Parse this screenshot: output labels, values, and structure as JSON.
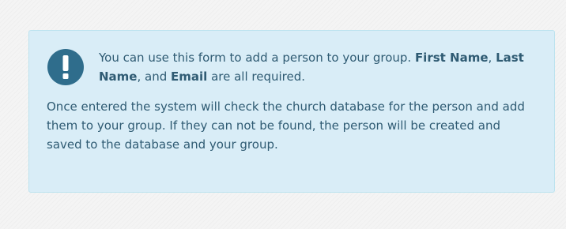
{
  "alert": {
    "icon": "exclamation-circle-icon",
    "icon_color": "#2f6d8c",
    "background_color": "#d9edf7",
    "text_color": "#2f5b73",
    "lead": {
      "part1": "You can use this form to add a person to your group. ",
      "first_name": "First Name",
      "sep1": ", ",
      "last_name": "Last Name",
      "sep2": ", and ",
      "email": "Email",
      "part2": " are all required."
    },
    "body": "Once entered the system will check the church database for the person and add them to your group. If they can not be found, the person will be created and saved to the database and your group."
  }
}
